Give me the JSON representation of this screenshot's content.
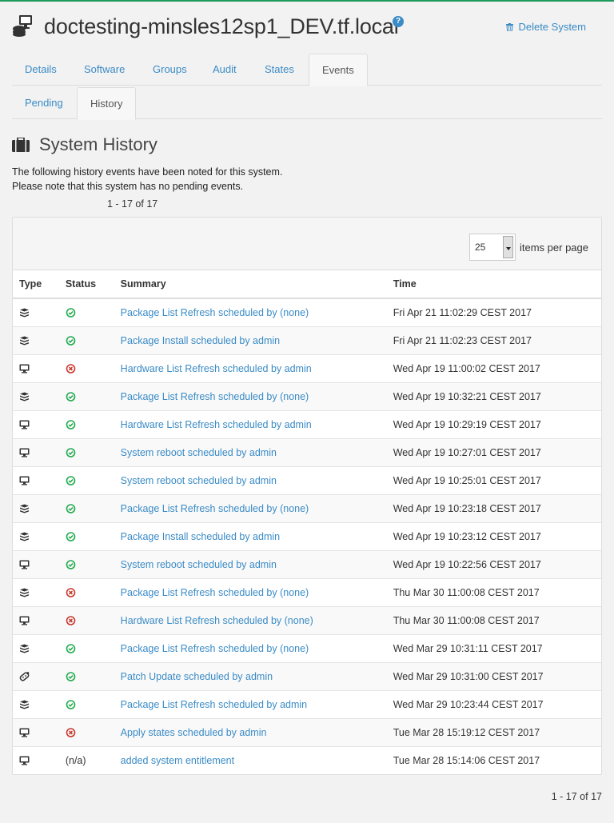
{
  "header": {
    "system_name": "doctesting-minsles12sp1_DEV.tf.local",
    "help": "?",
    "delete_label": "Delete System"
  },
  "tabs": [
    "Details",
    "Software",
    "Groups",
    "Audit",
    "States",
    "Events"
  ],
  "active_tab": "Events",
  "subtabs": [
    "Pending",
    "History"
  ],
  "active_subtab": "History",
  "section": {
    "title": "System History",
    "intro_line1": "The following history events have been noted for this system.",
    "intro_line2": "Please note that this system has no pending events."
  },
  "pager": {
    "top": "1 - 17 of 17",
    "bottom": "1 - 17 of 17"
  },
  "per_page": {
    "value": "25",
    "label": "items per page"
  },
  "colors": {
    "link": "#3a8bc6",
    "ok": "#1eaa4c",
    "fail": "#c8372d",
    "brand": "#1e9b5a"
  },
  "table": {
    "headers": {
      "type": "Type",
      "status": "Status",
      "summary": "Summary",
      "time": "Time"
    },
    "rows": [
      {
        "type": "package",
        "status": "ok",
        "summary": "Package List Refresh scheduled by (none)",
        "time": "Fri Apr 21 11:02:29 CEST 2017"
      },
      {
        "type": "package",
        "status": "ok",
        "summary": "Package Install scheduled by admin",
        "time": "Fri Apr 21 11:02:23 CEST 2017"
      },
      {
        "type": "system",
        "status": "failed",
        "summary": "Hardware List Refresh scheduled by admin",
        "time": "Wed Apr 19 11:00:02 CEST 2017"
      },
      {
        "type": "package",
        "status": "ok",
        "summary": "Package List Refresh scheduled by (none)",
        "time": "Wed Apr 19 10:32:21 CEST 2017"
      },
      {
        "type": "system",
        "status": "ok",
        "summary": "Hardware List Refresh scheduled by admin",
        "time": "Wed Apr 19 10:29:19 CEST 2017"
      },
      {
        "type": "system",
        "status": "ok",
        "summary": "System reboot scheduled by admin",
        "time": "Wed Apr 19 10:27:01 CEST 2017"
      },
      {
        "type": "system",
        "status": "ok",
        "summary": "System reboot scheduled by admin",
        "time": "Wed Apr 19 10:25:01 CEST 2017"
      },
      {
        "type": "package",
        "status": "ok",
        "summary": "Package List Refresh scheduled by (none)",
        "time": "Wed Apr 19 10:23:18 CEST 2017"
      },
      {
        "type": "package",
        "status": "ok",
        "summary": "Package Install scheduled by admin",
        "time": "Wed Apr 19 10:23:12 CEST 2017"
      },
      {
        "type": "system",
        "status": "ok",
        "summary": "System reboot scheduled by admin",
        "time": "Wed Apr 19 10:22:56 CEST 2017"
      },
      {
        "type": "package",
        "status": "failed",
        "summary": "Package List Refresh scheduled by (none)",
        "time": "Thu Mar 30 11:00:08 CEST 2017"
      },
      {
        "type": "system",
        "status": "failed",
        "summary": "Hardware List Refresh scheduled by (none)",
        "time": "Thu Mar 30 11:00:08 CEST 2017"
      },
      {
        "type": "package",
        "status": "ok",
        "summary": "Package List Refresh scheduled by (none)",
        "time": "Wed Mar 29 10:31:11 CEST 2017"
      },
      {
        "type": "patch",
        "status": "ok",
        "summary": "Patch Update scheduled by admin",
        "time": "Wed Mar 29 10:31:00 CEST 2017"
      },
      {
        "type": "package",
        "status": "ok",
        "summary": "Package List Refresh scheduled by admin",
        "time": "Wed Mar 29 10:23:44 CEST 2017"
      },
      {
        "type": "system",
        "status": "failed",
        "summary": "Apply states scheduled by admin",
        "time": "Tue Mar 28 15:19:12 CEST 2017"
      },
      {
        "type": "system",
        "status": "n/a",
        "status_text": "(n/a)",
        "summary": "added system entitlement",
        "time": "Tue Mar 28 15:14:06 CEST 2017"
      }
    ]
  }
}
